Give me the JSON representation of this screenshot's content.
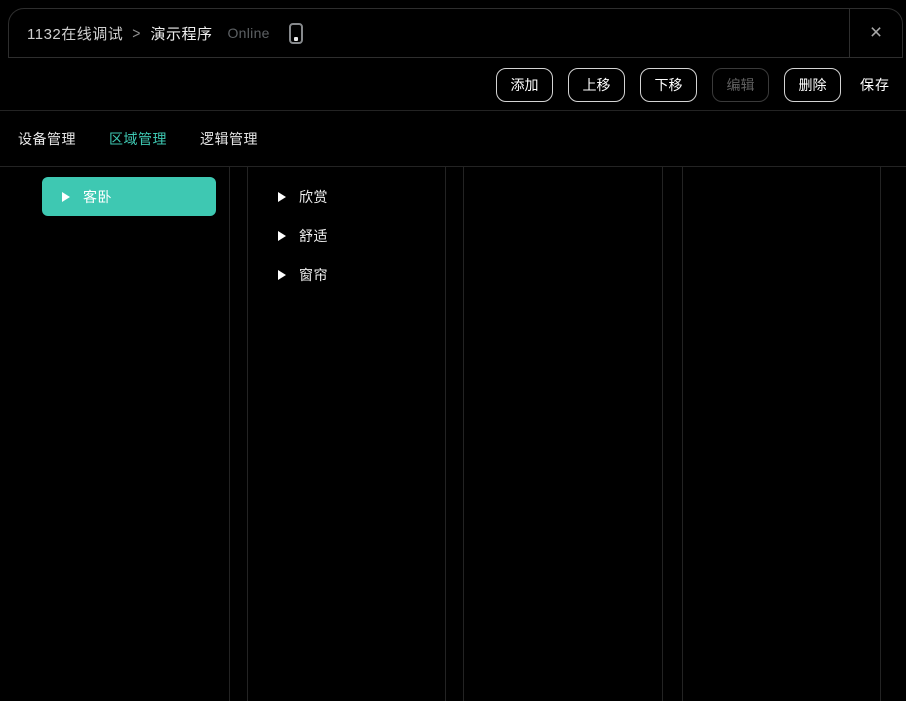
{
  "titlebar": {
    "breadcrumb_root": "1132在线调试",
    "breadcrumb_separator": ">",
    "breadcrumb_current": "演示程序",
    "status": "Online",
    "phone_icon": "phone-outline",
    "close_icon": "×"
  },
  "toolbar": {
    "buttons": [
      {
        "label": "添加",
        "disabled": false
      },
      {
        "label": "上移",
        "disabled": false
      },
      {
        "label": "下移",
        "disabled": false
      },
      {
        "label": "编辑",
        "disabled": true
      },
      {
        "label": "删除",
        "disabled": false
      }
    ],
    "save_label": "保存"
  },
  "tabs": [
    {
      "label": "设备管理",
      "active": false
    },
    {
      "label": "区域管理",
      "active": true
    },
    {
      "label": "逻辑管理",
      "active": false
    }
  ],
  "panels": [
    {
      "name": "level-1",
      "items": [
        {
          "label": "客卧",
          "selected": true
        }
      ]
    },
    {
      "name": "level-2",
      "items": [
        {
          "label": "欣赏",
          "selected": false
        },
        {
          "label": "舒适",
          "selected": false
        },
        {
          "label": "窗帘",
          "selected": false
        }
      ]
    },
    {
      "name": "level-3",
      "items": []
    },
    {
      "name": "level-4",
      "items": []
    }
  ],
  "colors": {
    "accent": "#3ec8b2",
    "background": "#000000",
    "border": "#2e2e2e"
  }
}
